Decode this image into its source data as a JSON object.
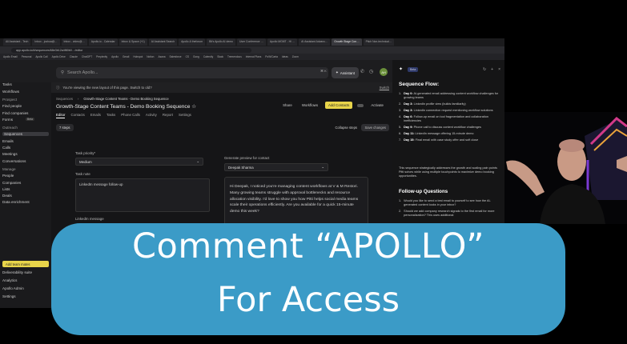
{
  "browser": {
    "tabs": [
      "All Assistant - Tech",
      "Inbox - joshua@…",
      "Inbox - video@…",
      "Apollo.io - Calendar",
      "Inbox & Space (+1)",
      "AI Assistant Search",
      "Apollo & theforum",
      "Bit's Apollo AI demo",
      "User Conference …",
      "Apollo MGMT - Hi …",
      "AI Assistant Advanc…",
      "Growth Stage Con…",
      "Pitch Non-technical…"
    ],
    "active_tab_index": 11,
    "url": "app.apollo.io/#/sequences/68e3b12a4f80b0…/editor",
    "bookmarks": [
      "Apollo Email",
      "Personal",
      "Apollo Call",
      "Apollo Drive",
      "Claude",
      "ChatGPT",
      "Perplexity",
      "Apollo",
      "Gmail",
      "Hubspot",
      "Notion",
      "Asana",
      "Salesforce",
      "CS",
      "Gong",
      "Calendly",
      "Slack",
      "Tremendous",
      "Internal Plans",
      "PoW/Carta",
      "Ideas",
      "Zoom"
    ]
  },
  "topbar": {
    "search_placeholder": "Search Apollo...",
    "search_shortcut": "⌘ K",
    "assistant_label": "Assistant",
    "avatar_initials": "AH"
  },
  "sidebar": {
    "items": [
      {
        "label": "For you",
        "head": false
      },
      {
        "label": "Tasks",
        "head": false
      },
      {
        "label": "Workflows",
        "head": false
      },
      {
        "label": "Prospect",
        "head": true
      },
      {
        "label": "Find people",
        "head": false
      },
      {
        "label": "Find companies",
        "head": false
      },
      {
        "label": "Forms",
        "head": false,
        "badge": "Beta"
      },
      {
        "label": "Outreach",
        "head": true
      },
      {
        "label": "Sequences",
        "head": false,
        "selected": true
      },
      {
        "label": "Emails",
        "head": false
      },
      {
        "label": "Calls",
        "head": false
      },
      {
        "label": "Meetings",
        "head": false
      },
      {
        "label": "Conversations",
        "head": false
      },
      {
        "label": "Manage",
        "head": true
      },
      {
        "label": "People",
        "head": false
      },
      {
        "label": "Companies",
        "head": false
      },
      {
        "label": "Lists",
        "head": false
      },
      {
        "label": "Deals",
        "head": false
      },
      {
        "label": "Data enrichment",
        "head": false
      }
    ],
    "add_team_label": "Add team mates",
    "bottom": [
      "Deliverability suite",
      "Analytics",
      "Apollo Admin",
      "Settings"
    ]
  },
  "banner": {
    "text": "You're viewing the new layout of this page. Switch to old?",
    "switch_label": "Switch"
  },
  "breadcrumb": [
    "Sequences",
    "Growth-Stage Content Teams - Demo Booking Sequence"
  ],
  "sequence_title": "Growth-Stage Content Teams - Demo Booking Sequence",
  "actions": {
    "share": "Share",
    "workflows": "Workflows",
    "add_contacts": "Add Contacts",
    "activate": "Activate"
  },
  "subnav": [
    "Editor",
    "Contacts",
    "Emails",
    "Tasks",
    "Phone Calls",
    "Activity",
    "Report",
    "Settings"
  ],
  "toolbar": {
    "steps_label": "7 steps",
    "collapse_label": "Collapse steps",
    "save_label": "Save changes"
  },
  "editor": {
    "task_priority_label": "Task priority*",
    "task_priority_value": "Medium",
    "task_note_label": "Task note",
    "task_note_value": "LinkedIn message follow-up",
    "linkedin_message_label": "LinkedIn message",
    "preview_label": "Generate preview for contact",
    "preview_contact": "Deepak Sharma",
    "preview_text": "Hi Deepak, I noticed you're managing content workflows at V & M Restori. Many growing teams struggle with approval bottlenecks and resource allocation visibility. I'd love to show you how Pitti helps social media teams scale their operations efficiently. Are you available for a quick 15-minute demo this week?"
  },
  "panel": {
    "beta_label": "Beta",
    "heading": "Sequence Flow:",
    "steps": [
      {
        "num": "1.",
        "day": "Day 0:",
        "text": "AI-generated email addressing content workflow challenges for growing teams"
      },
      {
        "num": "2.",
        "day": "Day 3:",
        "text": "LinkedIn profile view (builds familiarity)"
      },
      {
        "num": "3.",
        "day": "Day 3:",
        "text": "LinkedIn connection request mentioning workflow solutions"
      },
      {
        "num": "4.",
        "day": "Day 6:",
        "text": "Follow-up email on tool fragmentation and collaboration inefficiencies"
      },
      {
        "num": "5.",
        "day": "Day 9:",
        "text": "Phone call to discuss content workflow challenges"
      },
      {
        "num": "6.",
        "day": "Day 11:",
        "text": "LinkedIn message offering 15-minute demo"
      },
      {
        "num": "7.",
        "day": "Day 15:",
        "text": "Final email with case study offer and soft close"
      }
    ],
    "summary": "This sequence strategically addresses the growth and scaling pain points Pitti solves while using multiple touchpoints to maximize demo booking opportunities.",
    "followup_heading": "Follow-up Questions",
    "followups": [
      {
        "num": "1.",
        "text": "Would you like to send a test email to yourself to see how the AI-generated content looks in your inbox?"
      },
      {
        "num": "2.",
        "text": "Should we add company research signals to the first email for more personalization? This uses additional"
      }
    ]
  },
  "overlay": {
    "line1": "Comment “APOLLO”",
    "line2": "For Access",
    "color": "#3b9bc7"
  }
}
